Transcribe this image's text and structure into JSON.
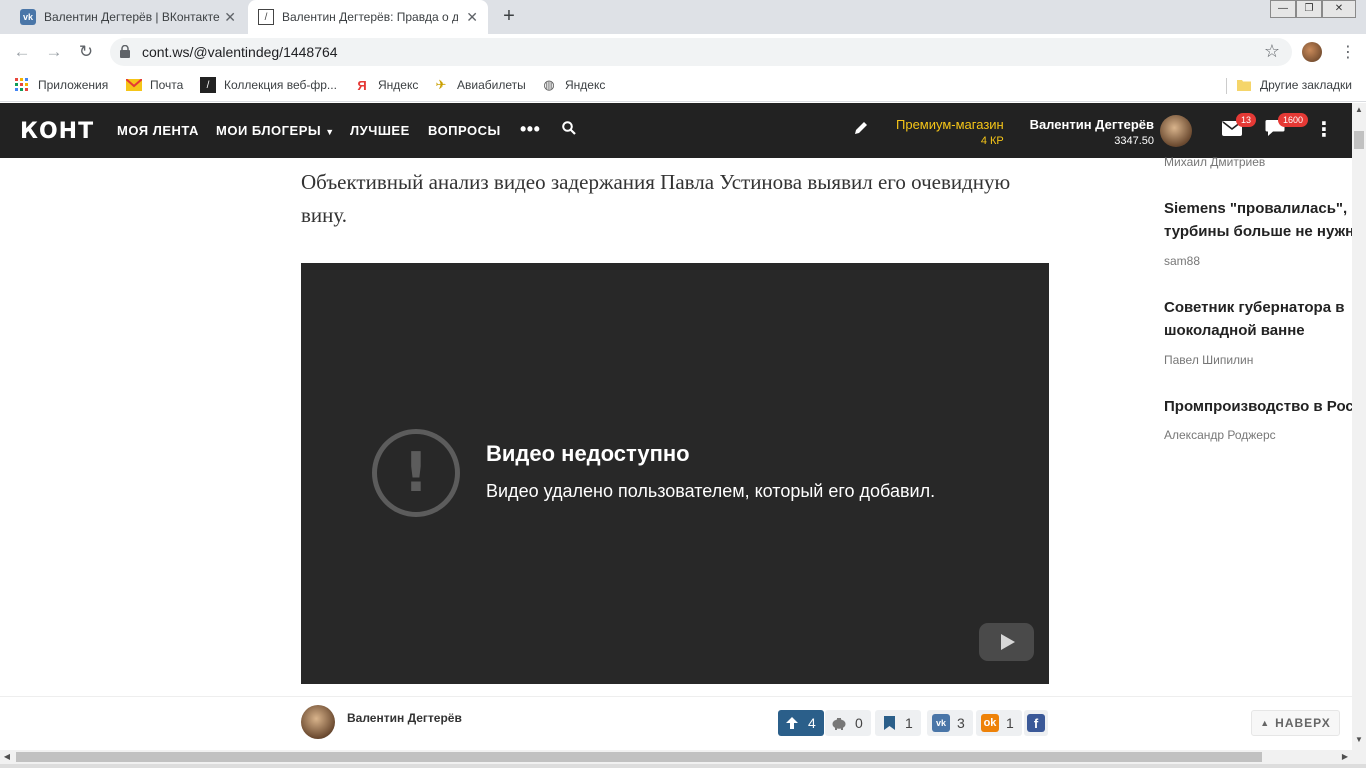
{
  "browser": {
    "tabs": [
      {
        "title": "Валентин Дегтерёв | ВКонтакте",
        "icon": "vk-icon"
      },
      {
        "title": "Валентин Дегтерёв: Правда о д",
        "icon": "kont-icon"
      }
    ],
    "url": "cont.ws/@valentindeg/1448764",
    "bookmarks": [
      {
        "label": "Приложения",
        "icon": "apps-grid-icon"
      },
      {
        "label": "Почта",
        "icon": "mail-icon"
      },
      {
        "label": "Коллекция веб-фр...",
        "icon": "collection-icon"
      },
      {
        "label": "Яндекс",
        "icon": "yandex-icon"
      },
      {
        "label": "Авиабилеты",
        "icon": "plane-icon"
      },
      {
        "label": "Яндекс",
        "icon": "globe-icon"
      }
    ],
    "other_bookmarks": "Другие закладки"
  },
  "site": {
    "logo": "КОНТ",
    "nav": [
      "МОЯ ЛЕНТА",
      "МОИ БЛОГЕРЫ",
      "ЛУЧШЕЕ",
      "ВОПРОСЫ"
    ],
    "premium_label": "Премиум-магазин",
    "premium_kp": "4 КР",
    "user_name": "Валентин Дегтерёв",
    "user_score": "3347.50",
    "mail_badge": "13",
    "chat_badge": "1600",
    "accent_color": "#f5c518",
    "header_bg": "#222222"
  },
  "article": {
    "lead": "Объективный анализ видео задержания Павла Устинова выявил его очевидную вину.",
    "video_title": "Видео недоступно",
    "video_subtitle": "Видео удалено пользователем, который его добавил."
  },
  "sidebar": {
    "top_author": "Михаил Дмитриев",
    "items": [
      {
        "title_line1": "Siemens \"провалилась\", Р",
        "title_line2": "турбины больше не нужн",
        "author": "sam88"
      },
      {
        "title_line1": "Советник губернатора в",
        "title_line2": "шоколадной ванне",
        "author": "Павел Шипилин"
      },
      {
        "title_line1": "Промпроизводство в Рос",
        "title_line2": "",
        "author": "Александр Роджерс"
      }
    ]
  },
  "bottombar": {
    "author": "Валентин Дегтерёв",
    "upvotes": "4",
    "donations": "0",
    "bookmarks": "1",
    "vk_shares": "3",
    "ok_shares": "1",
    "totop_label": "НАВЕРХ",
    "upvote_color": "#2b5f8a"
  }
}
